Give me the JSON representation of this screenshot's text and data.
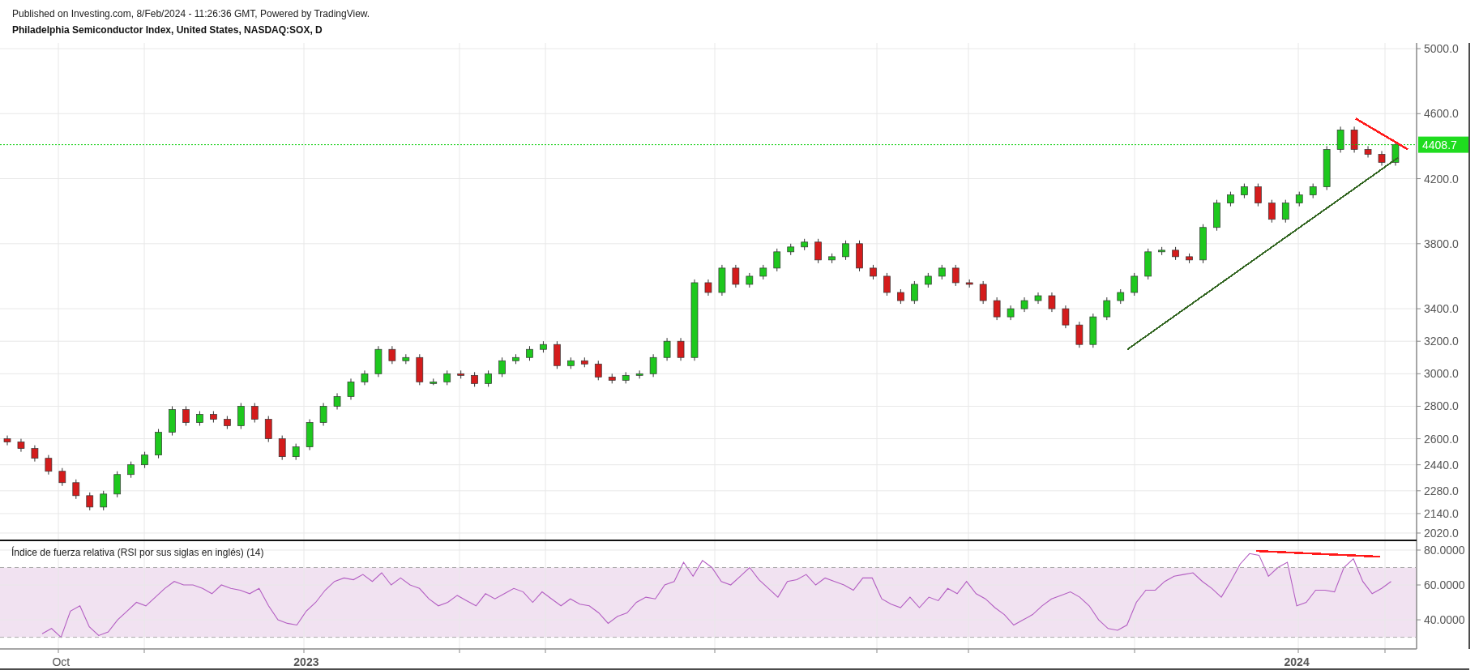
{
  "header": {
    "published": "Published on Investing.com, 8/Feb/2024 - 11:26:36 GMT, Powered by TradingView.",
    "title": "Philadelphia Semiconductor Index, United States, NASDAQ:SOX, D"
  },
  "price_chart": {
    "last_price": "4408.7",
    "trend_lines": [
      {
        "color": "#336622"
      },
      {
        "color": "#ff1a1a"
      }
    ],
    "chart_data": {
      "type": "candlestick",
      "grid": true,
      "ylim": [
        1970,
        5035
      ],
      "categories": [
        null,
        null,
        null,
        null,
        null,
        null,
        null,
        null,
        null,
        null,
        null,
        null,
        null,
        null,
        null,
        null,
        null,
        null,
        null,
        null,
        null,
        null,
        null,
        null,
        null,
        null,
        null,
        null,
        null,
        null,
        null,
        null,
        null,
        null,
        null,
        null,
        null,
        null,
        null,
        null,
        null,
        null,
        null,
        null,
        null,
        null,
        null,
        null,
        null,
        null,
        null,
        null,
        null,
        null,
        null,
        null,
        null,
        null,
        null,
        null,
        null,
        null,
        null,
        null,
        null,
        null,
        null,
        null,
        null,
        null,
        null,
        null,
        null,
        null,
        null,
        null,
        null,
        null,
        null,
        null,
        null,
        null,
        null,
        null,
        null,
        null,
        null,
        null,
        null,
        null,
        null,
        null,
        null,
        null,
        null,
        null,
        null,
        null,
        null,
        null,
        null,
        null
      ],
      "yticks": [
        {
          "value": 5000,
          "label": "5000.0"
        },
        {
          "value": 4600,
          "label": "4600.0"
        },
        {
          "value": 4200,
          "label": "4200.0"
        },
        {
          "value": 3800,
          "label": "3800.0"
        },
        {
          "value": 3400,
          "label": "3400.0"
        },
        {
          "value": 3200,
          "label": "3200.0"
        },
        {
          "value": 3000,
          "label": "3000.0"
        },
        {
          "value": 2800,
          "label": "2800.0"
        },
        {
          "value": 2600,
          "label": "2600.0"
        },
        {
          "value": 2440,
          "label": "2440.0"
        },
        {
          "value": 2280,
          "label": "2280.0"
        },
        {
          "value": 2140,
          "label": "2140.0"
        },
        {
          "value": 2020,
          "label": "2020.0"
        }
      ],
      "ohlc": [
        [
          2600,
          2620,
          2560,
          2580
        ],
        [
          2580,
          2600,
          2520,
          2540
        ],
        [
          2540,
          2560,
          2460,
          2480
        ],
        [
          2480,
          2500,
          2380,
          2400
        ],
        [
          2400,
          2420,
          2310,
          2330
        ],
        [
          2330,
          2350,
          2230,
          2250
        ],
        [
          2250,
          2270,
          2160,
          2180
        ],
        [
          2180,
          2280,
          2160,
          2260
        ],
        [
          2260,
          2400,
          2240,
          2380
        ],
        [
          2380,
          2460,
          2360,
          2440
        ],
        [
          2440,
          2520,
          2420,
          2500
        ],
        [
          2500,
          2660,
          2480,
          2640
        ],
        [
          2640,
          2800,
          2620,
          2780
        ],
        [
          2780,
          2800,
          2680,
          2700
        ],
        [
          2700,
          2770,
          2680,
          2750
        ],
        [
          2750,
          2770,
          2700,
          2720
        ],
        [
          2720,
          2740,
          2660,
          2680
        ],
        [
          2680,
          2820,
          2660,
          2800
        ],
        [
          2800,
          2820,
          2700,
          2720
        ],
        [
          2720,
          2740,
          2580,
          2600
        ],
        [
          2600,
          2620,
          2470,
          2490
        ],
        [
          2490,
          2570,
          2470,
          2550
        ],
        [
          2550,
          2720,
          2530,
          2700
        ],
        [
          2700,
          2820,
          2680,
          2800
        ],
        [
          2800,
          2880,
          2780,
          2860
        ],
        [
          2860,
          2970,
          2840,
          2950
        ],
        [
          2950,
          3020,
          2930,
          3000
        ],
        [
          3000,
          3170,
          2980,
          3150
        ],
        [
          3150,
          3170,
          3060,
          3080
        ],
        [
          3080,
          3120,
          3060,
          3100
        ],
        [
          3100,
          3120,
          2930,
          2950
        ],
        [
          2950,
          2970,
          2930,
          2950
        ],
        [
          2950,
          3020,
          2930,
          3000
        ],
        [
          3000,
          3020,
          2970,
          2990
        ],
        [
          2990,
          3010,
          2920,
          2940
        ],
        [
          2940,
          3020,
          2920,
          3000
        ],
        [
          3000,
          3100,
          2980,
          3080
        ],
        [
          3080,
          3120,
          3060,
          3100
        ],
        [
          3100,
          3170,
          3080,
          3150
        ],
        [
          3150,
          3200,
          3130,
          3180
        ],
        [
          3180,
          3200,
          3030,
          3050
        ],
        [
          3050,
          3100,
          3030,
          3080
        ],
        [
          3080,
          3100,
          3040,
          3060
        ],
        [
          3060,
          3080,
          2960,
          2980
        ],
        [
          2980,
          3000,
          2940,
          2960
        ],
        [
          2960,
          3010,
          2940,
          2990
        ],
        [
          2990,
          3020,
          2970,
          3000
        ],
        [
          3000,
          3120,
          2980,
          3100
        ],
        [
          3100,
          3220,
          3080,
          3200
        ],
        [
          3200,
          3220,
          3080,
          3100
        ],
        [
          3100,
          3580,
          3080,
          3560
        ],
        [
          3560,
          3580,
          3480,
          3500
        ],
        [
          3500,
          3670,
          3480,
          3650
        ],
        [
          3650,
          3670,
          3530,
          3550
        ],
        [
          3550,
          3620,
          3530,
          3600
        ],
        [
          3600,
          3670,
          3580,
          3650
        ],
        [
          3650,
          3770,
          3630,
          3750
        ],
        [
          3750,
          3800,
          3730,
          3780
        ],
        [
          3780,
          3830,
          3760,
          3810
        ],
        [
          3810,
          3830,
          3680,
          3700
        ],
        [
          3700,
          3740,
          3680,
          3720
        ],
        [
          3720,
          3820,
          3700,
          3800
        ],
        [
          3800,
          3820,
          3630,
          3650
        ],
        [
          3650,
          3670,
          3580,
          3600
        ],
        [
          3600,
          3620,
          3480,
          3500
        ],
        [
          3500,
          3520,
          3430,
          3450
        ],
        [
          3450,
          3570,
          3430,
          3550
        ],
        [
          3550,
          3620,
          3530,
          3600
        ],
        [
          3600,
          3670,
          3580,
          3650
        ],
        [
          3650,
          3670,
          3540,
          3560
        ],
        [
          3560,
          3580,
          3530,
          3550
        ],
        [
          3550,
          3570,
          3430,
          3450
        ],
        [
          3450,
          3470,
          3330,
          3350
        ],
        [
          3350,
          3420,
          3330,
          3400
        ],
        [
          3400,
          3470,
          3380,
          3450
        ],
        [
          3450,
          3500,
          3430,
          3480
        ],
        [
          3480,
          3500,
          3380,
          3400
        ],
        [
          3400,
          3420,
          3280,
          3300
        ],
        [
          3300,
          3320,
          3160,
          3180
        ],
        [
          3180,
          3370,
          3160,
          3350
        ],
        [
          3350,
          3470,
          3330,
          3450
        ],
        [
          3450,
          3520,
          3430,
          3500
        ],
        [
          3500,
          3620,
          3480,
          3600
        ],
        [
          3600,
          3770,
          3580,
          3750
        ],
        [
          3750,
          3780,
          3730,
          3760
        ],
        [
          3760,
          3780,
          3700,
          3720
        ],
        [
          3720,
          3740,
          3680,
          3700
        ],
        [
          3700,
          3920,
          3680,
          3900
        ],
        [
          3900,
          4070,
          3880,
          4050
        ],
        [
          4050,
          4120,
          4030,
          4100
        ],
        [
          4100,
          4170,
          4080,
          4150
        ],
        [
          4150,
          4170,
          4030,
          4050
        ],
        [
          4050,
          4070,
          3930,
          3950
        ],
        [
          3950,
          4070,
          3930,
          4050
        ],
        [
          4050,
          4120,
          4030,
          4100
        ],
        [
          4100,
          4170,
          4080,
          4150
        ],
        [
          4150,
          4400,
          4130,
          4380
        ],
        [
          4380,
          4520,
          4360,
          4500
        ],
        [
          4500,
          4520,
          4360,
          4380
        ],
        [
          4380,
          4400,
          4330,
          4350
        ],
        [
          4350,
          4370,
          4280,
          4300
        ],
        [
          4300,
          4430,
          4280,
          4409
        ]
      ]
    }
  },
  "rsi_chart": {
    "title": "Índice de fuerza relativa (RSI por sus siglas en inglés) (14)",
    "trend_lines": [
      {
        "color": "#ff1a1a"
      }
    ],
    "chart_data": {
      "type": "line",
      "grid": true,
      "ylim": [
        23.3,
        85.1
      ],
      "categories": [
        null,
        null,
        "Oct",
        null,
        null,
        null,
        null,
        null,
        null,
        null,
        null,
        null,
        null,
        null,
        null,
        null,
        null,
        null,
        null,
        null,
        null,
        null,
        null,
        null,
        null,
        null,
        null,
        null,
        "2023",
        null,
        null,
        null,
        null,
        null,
        null,
        null,
        null,
        null,
        null,
        null,
        null,
        null,
        null,
        null,
        null,
        null,
        null,
        null,
        null,
        null,
        null,
        null,
        null,
        null,
        null,
        null,
        null,
        null,
        null,
        null,
        null,
        null,
        null,
        null,
        null,
        null,
        null,
        null,
        null,
        null,
        null,
        null,
        null,
        null,
        null,
        null,
        null,
        null,
        null,
        null,
        null,
        null,
        null,
        null,
        null,
        null,
        null,
        null,
        null,
        null,
        null,
        null,
        null,
        null,
        null,
        null,
        null,
        null,
        null,
        null,
        null,
        null,
        null,
        null,
        null,
        null,
        null,
        null,
        null,
        null,
        null,
        null,
        null,
        null,
        null,
        null,
        null,
        null,
        null,
        null,
        null,
        null,
        null,
        null,
        null,
        null,
        null,
        null,
        null,
        null,
        null,
        null,
        null,
        "2024",
        null,
        null,
        null,
        null,
        null,
        null,
        null,
        null,
        null,
        null
      ],
      "yticks": [
        {
          "value": 80,
          "label": "80.0000"
        },
        {
          "value": 60,
          "label": "60.0000"
        },
        {
          "value": 40,
          "label": "40.0000"
        }
      ],
      "series": [
        {
          "color": "#b35ec2",
          "values": [
            32,
            35,
            30,
            45,
            48,
            36,
            31,
            33,
            40,
            45,
            50,
            48,
            53,
            58,
            62,
            60,
            60,
            58,
            55,
            60,
            58,
            57,
            55,
            58,
            48,
            40,
            38,
            37,
            45,
            50,
            57,
            62,
            64,
            63,
            66,
            62,
            67,
            60,
            64,
            60,
            58,
            52,
            48,
            50,
            54,
            51,
            48,
            55,
            52,
            55,
            58,
            56,
            50,
            56,
            52,
            48,
            52,
            49,
            48,
            44,
            38,
            42,
            44,
            50,
            53,
            52,
            60,
            62,
            73,
            65,
            74,
            70,
            62,
            60,
            65,
            70,
            63,
            58,
            53,
            62,
            63,
            66,
            60,
            64,
            62,
            60,
            57,
            64,
            64,
            52,
            49,
            47,
            53,
            47,
            53,
            51,
            58,
            55,
            62,
            55,
            52,
            47,
            43,
            37,
            40,
            43,
            48,
            52,
            54,
            56,
            53,
            48,
            40,
            35,
            34,
            37,
            50,
            57,
            57,
            62,
            65,
            66,
            67,
            62,
            58,
            53,
            62,
            72,
            78,
            77,
            65,
            70,
            73,
            48,
            50,
            57,
            57,
            56,
            70,
            75,
            62,
            55,
            58,
            62
          ]
        }
      ]
    }
  }
}
